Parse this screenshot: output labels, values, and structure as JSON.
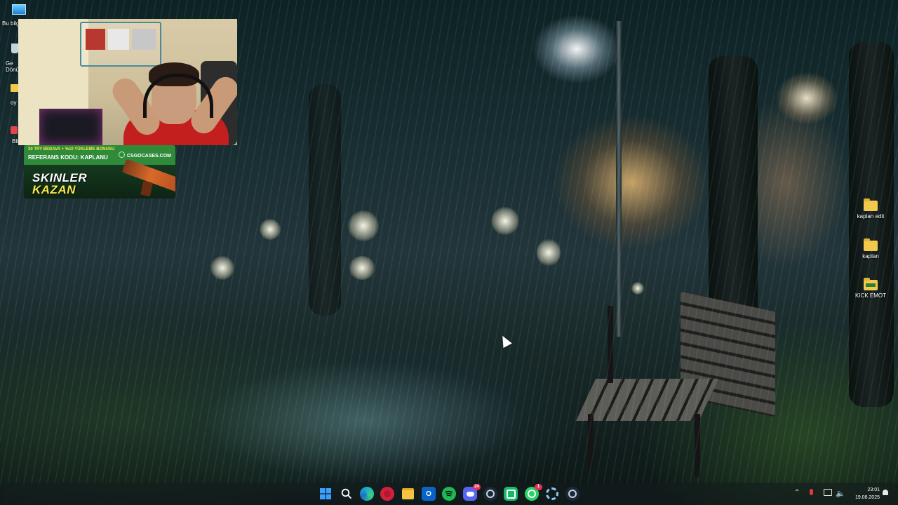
{
  "desktop": {
    "left_icons": [
      {
        "label": "Bu bilg",
        "icon": "this-pc-icon"
      },
      {
        "label": "Ge Dönü",
        "icon": "recycle-bin-icon"
      },
      {
        "label": "oy",
        "icon": "folder-icon"
      },
      {
        "label": "Bli",
        "icon": "shortcut-icon"
      }
    ],
    "right_icons": [
      {
        "label": "kaplan edit",
        "icon": "folder-icon"
      },
      {
        "label": "kaplan",
        "icon": "folder-icon"
      },
      {
        "label": "KICK EMOT",
        "icon": "folder-icon"
      }
    ]
  },
  "promo": {
    "line1": "30 TRY BEDAVA + %10 YÜKLEME BONUSU",
    "line2": "REFERANS KODU: KAPLANU",
    "brand": "CSGOCASES.COM",
    "headline_1": "SKINLER",
    "headline_2": "KAZAN"
  },
  "taskbar": {
    "apps": [
      {
        "name": "start",
        "icon": "windows-start-icon",
        "color": "#3aa0ff"
      },
      {
        "name": "search",
        "icon": "search-icon",
        "color": "#ffffff"
      },
      {
        "name": "edge",
        "icon": "edge-browser-icon",
        "color": "#1fb0c8"
      },
      {
        "name": "opera",
        "icon": "opera-browser-icon",
        "color": "#d0213a"
      },
      {
        "name": "explorer",
        "icon": "file-explorer-icon",
        "color": "#f5c242"
      },
      {
        "name": "outlook",
        "icon": "outlook-icon",
        "color": "#0a64c8"
      },
      {
        "name": "spotify",
        "icon": "spotify-icon",
        "color": "#1db954"
      },
      {
        "name": "discord",
        "icon": "discord-icon",
        "color": "#5865f2",
        "badge": "24"
      },
      {
        "name": "steam",
        "icon": "steam-icon",
        "color": "#1b2838"
      },
      {
        "name": "app-green",
        "icon": "green-app-icon",
        "color": "#16b86a"
      },
      {
        "name": "whatsapp",
        "icon": "whatsapp-icon",
        "color": "#25d366",
        "badge": "1"
      },
      {
        "name": "app-gear",
        "icon": "gear-app-icon",
        "color": "#5aa0d8"
      },
      {
        "name": "steam-2",
        "icon": "steam-icon",
        "color": "#1b2838"
      }
    ],
    "clock_time": "23:01",
    "clock_date": "19.08.2025"
  }
}
